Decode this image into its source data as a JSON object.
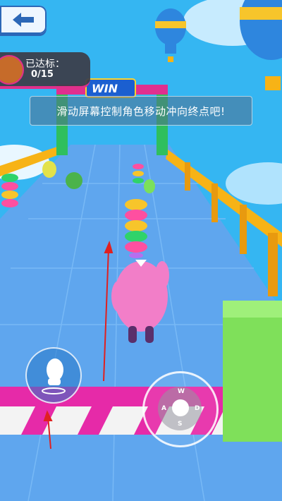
{
  "hud": {
    "back_button": "back-arrow-icon",
    "progress_label": "已达标：",
    "progress_value": "0/15",
    "tip": "滑动屏幕控制角色移动冲向终点吧!"
  },
  "scene": {
    "finish_sign": "WIN"
  },
  "joystick": {
    "up": "W",
    "left": "A",
    "right": "D",
    "down": "S"
  },
  "colors": {
    "sky": "#35b6f2",
    "track": "#5fa6ee",
    "rail": "#f7b316",
    "start_stripe": "#e62aa8",
    "block": "#7fe05a"
  }
}
